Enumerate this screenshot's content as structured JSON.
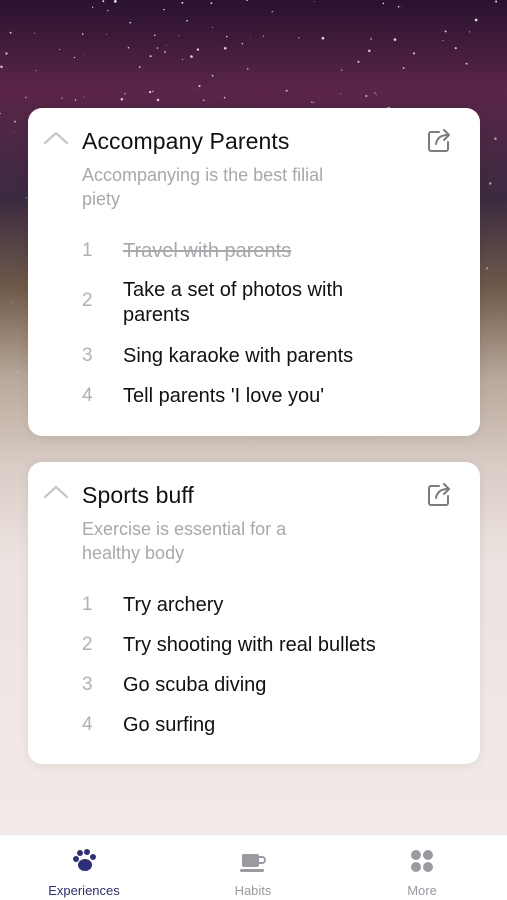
{
  "cards": [
    {
      "title": "Accompany Parents",
      "subtitle": "Accompanying is the best filial piety",
      "items": [
        {
          "num": "1",
          "text": "Travel with parents",
          "done": true
        },
        {
          "num": "2",
          "text": "Take a set of photos with parents",
          "done": false
        },
        {
          "num": "3",
          "text": "Sing karaoke with parents",
          "done": false
        },
        {
          "num": "4",
          "text": "Tell parents 'I love you'",
          "done": false
        }
      ]
    },
    {
      "title": "Sports buff",
      "subtitle": "Exercise is essential for a healthy body",
      "items": [
        {
          "num": "1",
          "text": "Try archery",
          "done": false
        },
        {
          "num": "2",
          "text": "Try shooting with real bullets",
          "done": false
        },
        {
          "num": "3",
          "text": "Go scuba diving",
          "done": false
        },
        {
          "num": "4",
          "text": "Go surfing",
          "done": false
        }
      ]
    }
  ],
  "tabs": [
    {
      "label": "Experiences",
      "icon": "paw-icon",
      "active": true
    },
    {
      "label": "Habits",
      "icon": "coffee-cup-icon",
      "active": false
    },
    {
      "label": "More",
      "icon": "grid-icon",
      "active": false
    }
  ],
  "colors": {
    "accent": "#2e2f7a",
    "inactive": "#9a9aa0"
  }
}
